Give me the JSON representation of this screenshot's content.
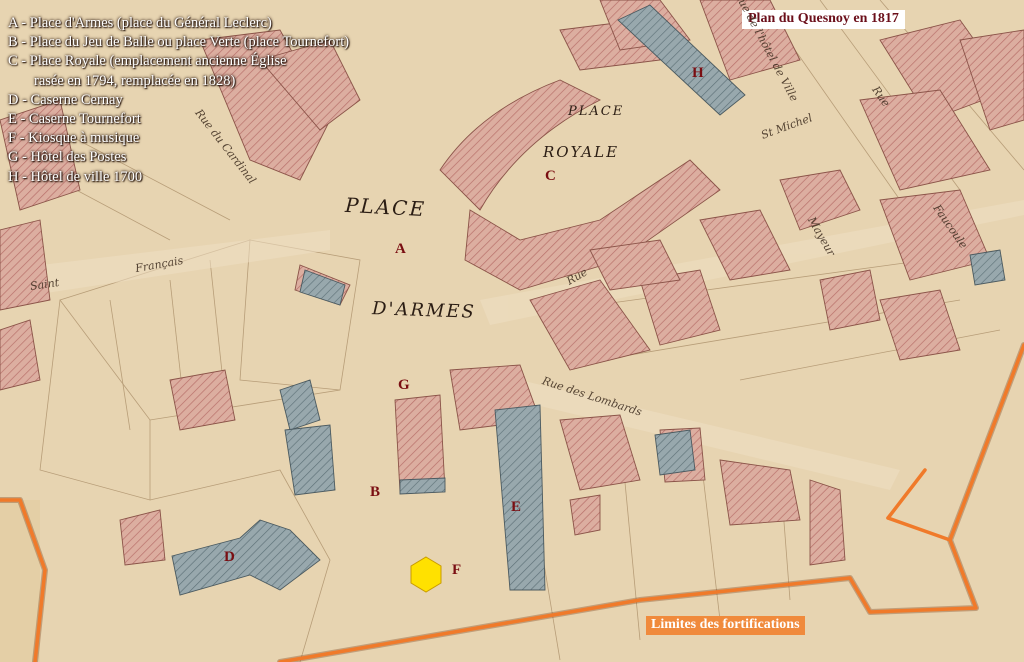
{
  "map": {
    "title": "Plan du Quesnoy en 1817",
    "fortifications_label": "Limites des fortifications",
    "colors": {
      "parchment": "#e7d4b1",
      "buildings": "#d9a79a",
      "military": "#8fa0a6",
      "fortification_line": "#f07a2a",
      "marker_text": "#7a0e12",
      "kiosk_marker": "#ffe100"
    },
    "legend": [
      {
        "text": "A - Place d'Armes (place du Général Leclerc)"
      },
      {
        "text": "B - Place du Jeu de Balle ou place Verte (place Tournefort)"
      },
      {
        "text": "C - Place Royale (emplacement ancienne Église"
      },
      {
        "text": "rasée en 1794, remplacée en 1828)"
      },
      {
        "text": "D - Caserne Cernay"
      },
      {
        "text": "E - Caserne Tournefort"
      },
      {
        "text": "F - Kiosque à musique"
      },
      {
        "text": "G - Hôtel des Postes"
      },
      {
        "text": "H - Hôtel de ville 1700"
      }
    ],
    "markers": {
      "A": "A",
      "B": "B",
      "C": "C",
      "D": "D",
      "E": "E",
      "F": "F",
      "G": "G",
      "H": "H"
    },
    "map_labels": {
      "place_armes_1": "PLACE",
      "place_armes_2": "D'ARMES",
      "place_royale_1": "PLACE",
      "place_royale_2": "ROYALE"
    },
    "streets": {
      "s1": "Rue de l'hôtel de Ville",
      "s2": "Rue",
      "s3": "Faucoule",
      "s4": "Rue des Lombards",
      "s5": "Français",
      "s6": "Saint",
      "s7": "St Michel",
      "s8": "Rue",
      "s9": "Mayeur",
      "s10": "Rue du Cardinal"
    }
  }
}
